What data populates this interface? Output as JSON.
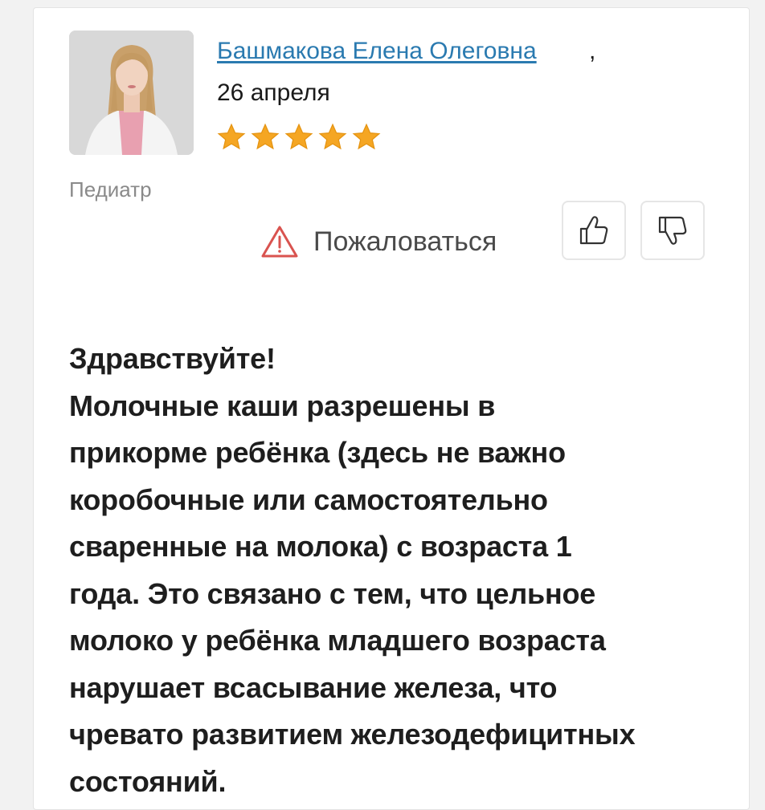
{
  "review": {
    "author": "Башмакова Елена Олеговна",
    "comma": ",",
    "date": "26 апреля",
    "rating": 5,
    "specialty": "Педиатр",
    "complain_label": "Пожаловаться",
    "body_lines": [
      "Здравствуйте!",
      "Молочные каши разрешены в",
      "прикорме ребёнка (здесь не важно",
      "коробочные или самостоятельно",
      "сваренные на молока) с возраста 1",
      "года. Это связано с тем, что цельное",
      "молоко у ребёнка младшего возраста",
      "нарушает всасывание железа, что",
      "чревато развитием железодефицитных",
      "состояний."
    ]
  },
  "icons": {
    "star": "star-icon",
    "warning": "warning-triangle-icon",
    "like": "thumbs-up-icon",
    "dislike": "thumbs-down-icon"
  },
  "colors": {
    "link": "#2a7ab0",
    "star": "#f5a623",
    "warning": "#d9534f"
  }
}
